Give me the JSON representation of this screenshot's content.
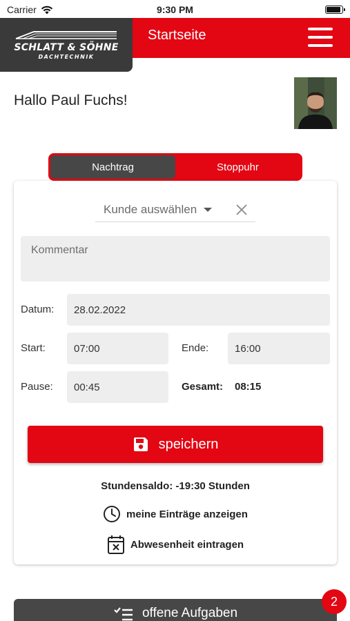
{
  "status_bar": {
    "carrier": "Carrier",
    "time": "9:30 PM"
  },
  "header": {
    "logo_title": "SCHLATT & SÖHNE",
    "logo_subtitle": "DACHTECHNIK",
    "title": "Startseite",
    "menu_icon": "hamburger-menu-icon"
  },
  "greeting": "Hallo Paul Fuchs!",
  "tabs": [
    {
      "label": "Nachtrag",
      "active": true
    },
    {
      "label": "Stoppuhr",
      "active": false
    }
  ],
  "form": {
    "customer_placeholder": "Kunde auswählen",
    "comment_placeholder": "Kommentar",
    "date_label": "Datum:",
    "date_value": "28.02.2022",
    "start_label": "Start:",
    "start_value": "07:00",
    "end_label": "Ende:",
    "end_value": "16:00",
    "pause_label": "Pause:",
    "pause_value": "00:45",
    "total_label": "Gesamt:",
    "total_value": "08:15",
    "save_label": "speichern"
  },
  "saldo": "Stundensaldo: -19:30 Stunden",
  "links": {
    "entries": "meine Einträge anzeigen",
    "absence": "Abwesenheit eintragen"
  },
  "bottom": {
    "label": "offene Aufgaben",
    "badge": "2"
  },
  "colors": {
    "brand_red": "#e30613",
    "dark_gray": "#474747",
    "field_bg": "#eeeeee"
  }
}
